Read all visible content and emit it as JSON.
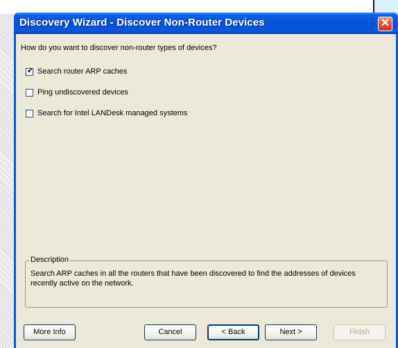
{
  "window": {
    "title": "Discovery Wizard - Discover Non-Router Devices",
    "close_glyph": "✕"
  },
  "main": {
    "question": "How do you want to discover non-router types of devices?",
    "options": [
      {
        "label": "Search router ARP caches",
        "checked": true,
        "check_glyph": "✔"
      },
      {
        "label": "Ping undiscovered devices",
        "checked": false
      },
      {
        "label": "Search for Intel LANDesk managed systems",
        "checked": false
      }
    ],
    "description": {
      "legend": "Description",
      "text": "Search ARP caches in all the routers that have been discovered to find the addresses of devices recently active on the network."
    }
  },
  "buttons": {
    "more_info": "More Info",
    "cancel": "Cancel",
    "back": "< Back",
    "next": "Next >",
    "finish": "Finish"
  },
  "colors": {
    "titlebar_blue": "#0652d6",
    "dialog_face": "#ece9d8",
    "close_red": "#e2502a"
  },
  "icons": {
    "close": "close-icon",
    "check": "checkmark-icon"
  }
}
